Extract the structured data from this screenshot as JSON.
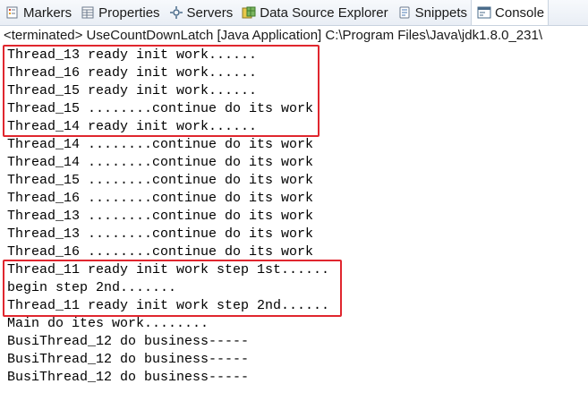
{
  "tabs": [
    {
      "label": "Markers",
      "icon": "markers-icon",
      "active": false
    },
    {
      "label": "Properties",
      "icon": "properties-icon",
      "active": false
    },
    {
      "label": "Servers",
      "icon": "servers-icon",
      "active": false
    },
    {
      "label": "Data Source Explorer",
      "icon": "data-source-explorer-icon",
      "active": false
    },
    {
      "label": "Snippets",
      "icon": "snippets-icon",
      "active": false
    },
    {
      "label": "Console",
      "icon": "console-icon",
      "active": true
    }
  ],
  "console": {
    "status": "<terminated> UseCountDownLatch [Java Application] C:\\Program Files\\Java\\jdk1.8.0_231\\",
    "lines": [
      "Thread_13 ready init work......",
      "Thread_16 ready init work......",
      "Thread_15 ready init work......",
      "Thread_15 ........continue do its work",
      "Thread_14 ready init work......",
      "Thread_14 ........continue do its work",
      "Thread_14 ........continue do its work",
      "Thread_15 ........continue do its work",
      "Thread_16 ........continue do its work",
      "Thread_13 ........continue do its work",
      "Thread_13 ........continue do its work",
      "Thread_16 ........continue do its work",
      "Thread_11 ready init work step 1st......",
      "begin step 2nd.......",
      "Thread_11 ready init work step 2nd......",
      "Main do ites work........",
      "BusiThread_12 do business-----",
      "BusiThread_12 do business-----",
      "BusiThread_12 do business-----"
    ]
  },
  "colors": {
    "highlight": "#e0262e",
    "tab_bar": "#e9eef5",
    "text": "#000000"
  }
}
